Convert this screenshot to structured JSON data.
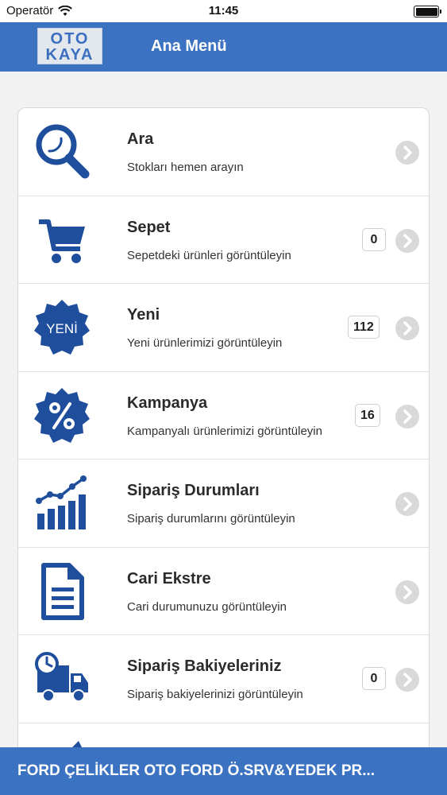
{
  "status_bar": {
    "carrier": "Operatör",
    "time": "11:45",
    "wifi_icon": "wifi-icon",
    "battery_icon": "battery-icon"
  },
  "nav": {
    "logo_line1": "OTO",
    "logo_line2": "KAYA",
    "title": "Ana Menü"
  },
  "menu": [
    {
      "title": "Ara",
      "subtitle": "Stokları hemen arayın",
      "icon": "search-icon",
      "badge": ""
    },
    {
      "title": "Sepet",
      "subtitle": "Sepetdeki ürünleri görüntüleyin",
      "icon": "cart-icon",
      "badge": "0"
    },
    {
      "title": "Yeni",
      "subtitle": "Yeni ürünlerimizi görüntüleyin",
      "icon": "new-badge-icon",
      "icon_text": "YENİ",
      "badge": "112"
    },
    {
      "title": "Kampanya",
      "subtitle": "Kampanyalı ürünlerimizi görüntüleyin",
      "icon": "percent-badge-icon",
      "badge": "16"
    },
    {
      "title": "Sipariş Durumları",
      "subtitle": "Sipariş durumlarını görüntüleyin",
      "icon": "bar-chart-icon",
      "badge": ""
    },
    {
      "title": "Cari Ekstre",
      "subtitle": "Cari durumunuzu görüntüleyin",
      "icon": "document-icon",
      "badge": ""
    },
    {
      "title": "Sipariş Bakiyeleriniz",
      "subtitle": "Sipariş bakiyelerinizi görüntüleyin",
      "icon": "delivery-truck-icon",
      "badge": "0"
    }
  ],
  "footer": {
    "text": "FORD ÇELİKLER OTO FORD Ö.SRV&YEDEK PR..."
  },
  "colors": {
    "brand_blue": "#3b72c2",
    "icon_blue": "#1f4e9c",
    "chevron_gray": "#d9d9d9"
  }
}
